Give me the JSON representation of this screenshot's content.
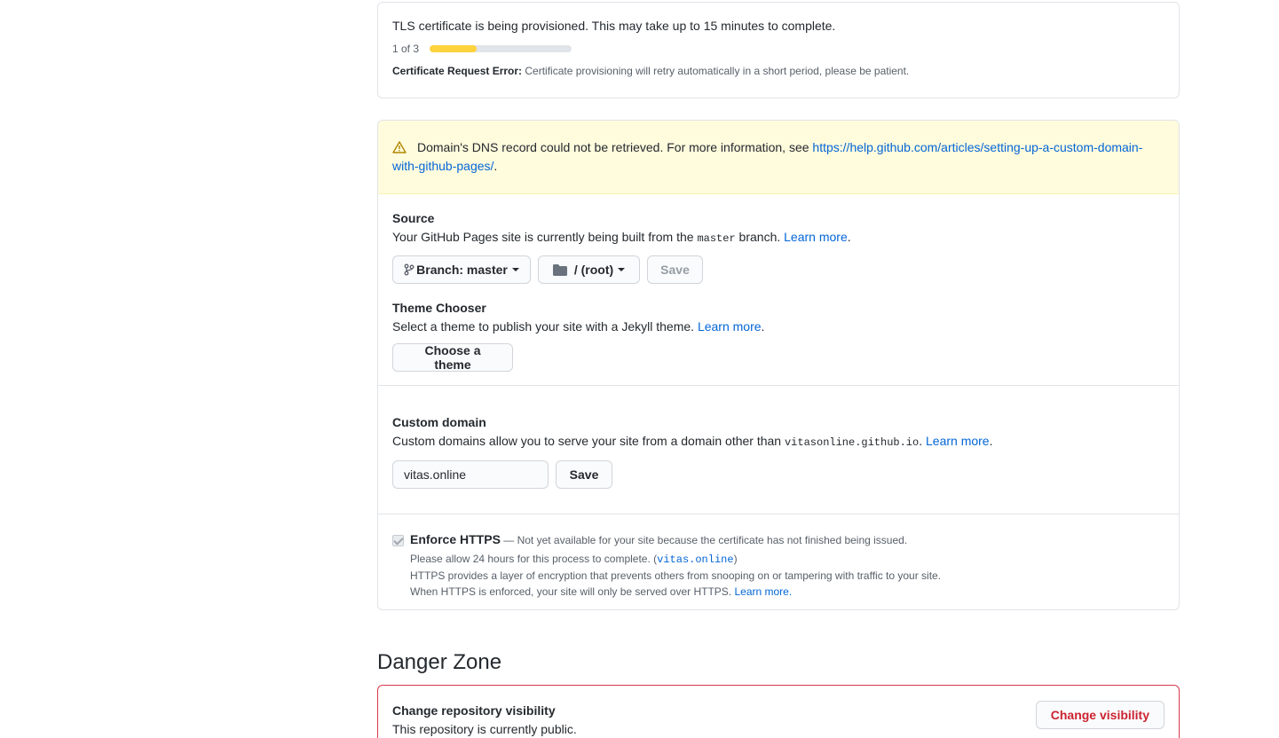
{
  "tls": {
    "message": "TLS certificate is being provisioned. This may take up to 15 minutes to complete.",
    "step_label": "1 of 3",
    "progress_fraction": 0.333,
    "error_label": "Certificate Request Error:",
    "error_text": " Certificate provisioning will retry automatically in a short period, please be patient."
  },
  "warning": {
    "text": "Domain's DNS record could not be retrieved. For more information, see ",
    "link": "https://help.github.com/articles/setting-up-a-custom-domain-with-github-pages/",
    "suffix": "."
  },
  "source": {
    "heading": "Source",
    "desc_prefix": "Your GitHub Pages site is currently being built from the ",
    "branch_code": "master",
    "desc_suffix": " branch. ",
    "learn_more": "Learn more",
    "period": ".",
    "branch_button": "Branch: master",
    "folder_button": "/ (root)",
    "save_button": "Save"
  },
  "theme": {
    "heading": "Theme Chooser",
    "desc": "Select a theme to publish your site with a Jekyll theme. ",
    "learn_more": "Learn more",
    "period": ".",
    "choose_button": "Choose a theme"
  },
  "custom_domain": {
    "heading": "Custom domain",
    "desc": "Custom domains allow you to serve your site from a domain other than ",
    "domain_code": "vitasonline.github.io",
    "desc_suffix": ". ",
    "learn_more": "Learn more",
    "period": ".",
    "input_value": "vitas.online",
    "save_button": "Save"
  },
  "https": {
    "label": "Enforce HTTPS",
    "note": " — Not yet available for your site because the certificate has not finished being issued.",
    "line2_prefix": "Please allow 24 hours for this process to complete. (",
    "line2_code": "vitas.online",
    "line2_suffix": ")",
    "line3": "HTTPS provides a layer of encryption that prevents others from snooping on or tampering with traffic to your site.",
    "line4": "When HTTPS is enforced, your site will only be served over HTTPS. ",
    "learn_more": "Learn more."
  },
  "danger": {
    "title": "Danger Zone",
    "visibility_heading": "Change repository visibility",
    "visibility_desc": "This repository is currently public.",
    "visibility_button": "Change visibility"
  },
  "colors": {
    "progress_fill": "#ffd33d",
    "warning_bg": "#fffbdd",
    "link": "#0366d6",
    "danger": "#d73a49"
  }
}
